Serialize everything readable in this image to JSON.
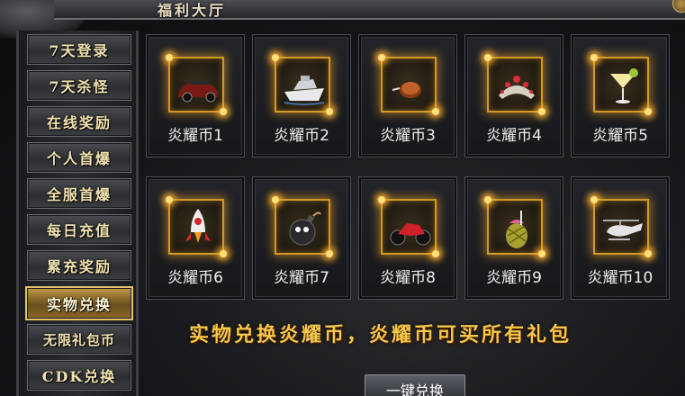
{
  "window": {
    "title": "福利大厅"
  },
  "menu": {
    "items": [
      {
        "label": "7天登录",
        "active": false
      },
      {
        "label": "7天杀怪",
        "active": false
      },
      {
        "label": "在线奖励",
        "active": false
      },
      {
        "label": "个人首爆",
        "active": false
      },
      {
        "label": "全服首爆",
        "active": false
      },
      {
        "label": "每日充值",
        "active": false
      },
      {
        "label": "累充奖励",
        "active": false
      },
      {
        "label": "实物兑换",
        "active": true
      },
      {
        "label": "无限礼包币",
        "active": false
      },
      {
        "label": "CDK兑换",
        "active": false
      }
    ]
  },
  "rewards": [
    {
      "label": "炎耀币1",
      "icon": "sports-car-icon"
    },
    {
      "label": "炎耀币2",
      "icon": "yacht-icon"
    },
    {
      "label": "炎耀币3",
      "icon": "coin-icon"
    },
    {
      "label": "炎耀币4",
      "icon": "tiara-icon"
    },
    {
      "label": "炎耀币5",
      "icon": "cocktail-icon"
    },
    {
      "label": "炎耀币6",
      "icon": "rocket-icon"
    },
    {
      "label": "炎耀币7",
      "icon": "bomb-icon"
    },
    {
      "label": "炎耀币8",
      "icon": "motorcycle-icon"
    },
    {
      "label": "炎耀币9",
      "icon": "pineapple-drink-icon"
    },
    {
      "label": "炎耀币10",
      "icon": "helicopter-icon"
    }
  ],
  "slogan": "实物兑换炎耀币，炎耀币可买所有礼包",
  "actions": {
    "exchange_label": "一键兑换"
  },
  "colors": {
    "accent": "#e6c36a",
    "slogan": "#f4c64a",
    "glow": "#ffb030"
  }
}
